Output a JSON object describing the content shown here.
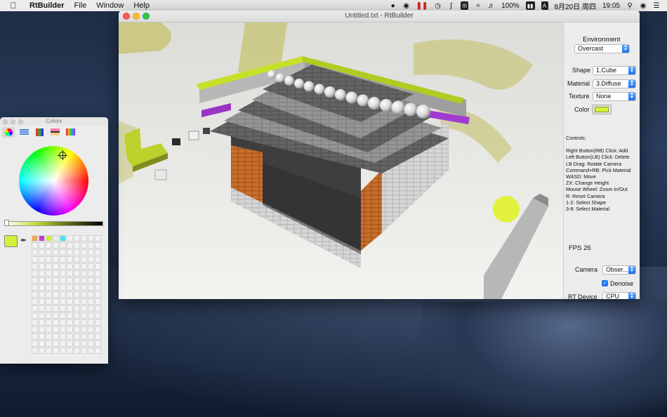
{
  "menubar": {
    "app_name": "RtBuilder",
    "menus": [
      "File",
      "Window",
      "Help"
    ],
    "battery": "100%",
    "date": "8月20日 周四",
    "time": "19:05",
    "input_method": "A"
  },
  "window": {
    "title": "Untitled.txt - RtBuilder"
  },
  "sidebar": {
    "environment_label": "Environment",
    "environment_value": "Overcast",
    "shape_label": "Shape",
    "shape_value": "1.Cube",
    "material_label": "Material",
    "material_value": "3.Diffuse",
    "texture_label": "Texture",
    "texture_value": "None",
    "color_label": "Color",
    "color_value": "#d4ef3a",
    "controls_title": "Controls:",
    "controls": [
      "Right Button(RB) Click: Add",
      "Left Button(LB) Click: Delete",
      "LB Drag: Rotate Camera",
      "Command+RB: Pick Material",
      "WASD: Move",
      "ZX: Change Height",
      "Mouse Wheel: Zoom In/Out",
      "R: Reset Camera",
      "1-2: Select Shape",
      "3-8: Select Material"
    ],
    "fps": "FPS 26",
    "camera_label": "Camera",
    "camera_value": "Obser...",
    "denoise_label": "Denoise",
    "denoise_checked": true,
    "rtdevice_label": "RT Device",
    "rtdevice_value": "CPU"
  },
  "colors_panel": {
    "title": "Colors",
    "current_color": "#d4ef3a",
    "swatches": [
      "#f5a45a",
      "#c43cd8",
      "#d4ef3a",
      "#ffffff",
      "#4ee0ee"
    ]
  }
}
